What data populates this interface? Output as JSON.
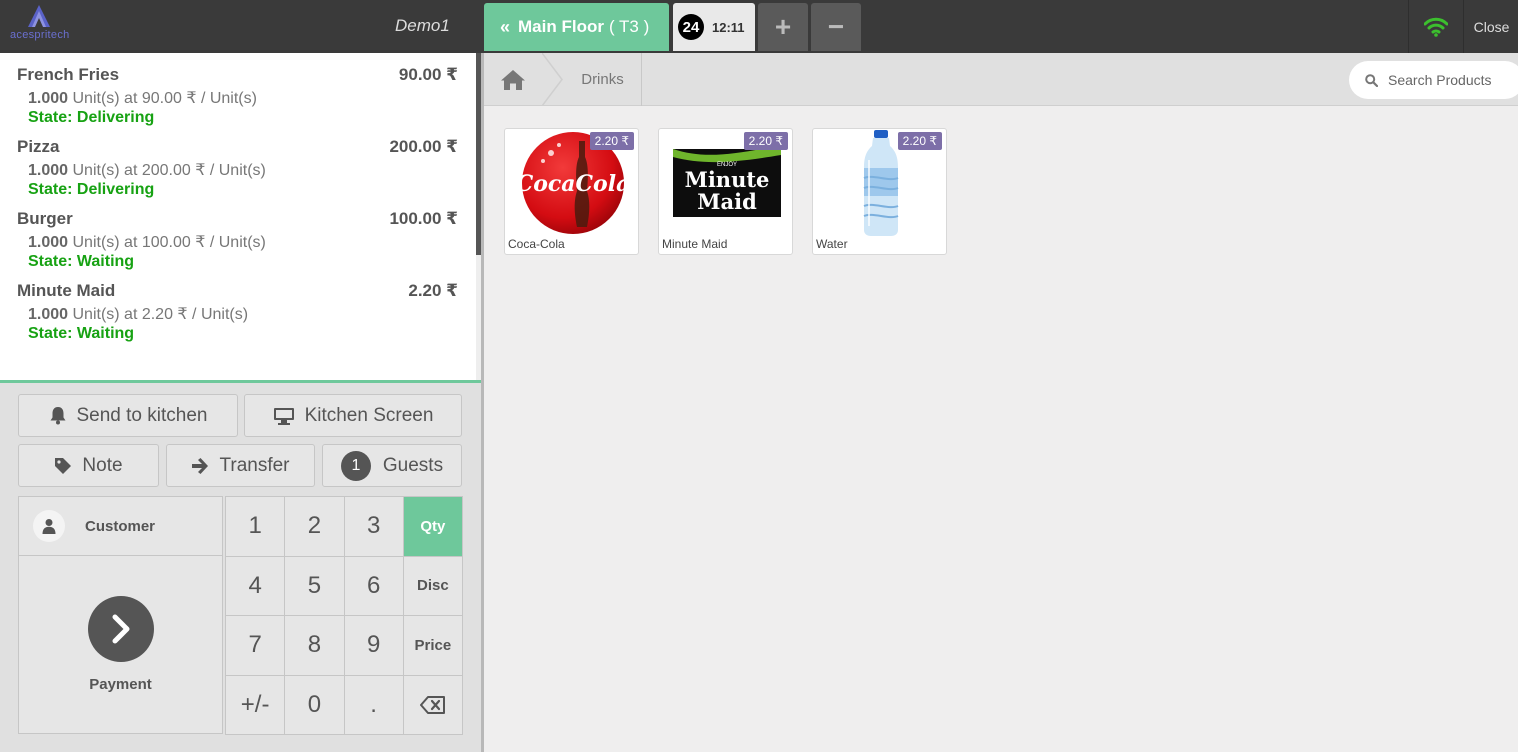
{
  "header": {
    "logo_text": "acespritech",
    "shop_name": "Demo1",
    "floor_label": "Main Floor",
    "table_label": "( T3 )",
    "order_number": "24",
    "order_time": "12:11",
    "add_order_symbol": "+",
    "remove_order_symbol": "−",
    "close_label": "Close",
    "wifi_color": "#3cbf2e"
  },
  "order": {
    "lines": [
      {
        "name": "French Fries",
        "price": "90.00 ₹",
        "qty": "1.000",
        "unit_info": " Unit(s) at 90.00 ₹ / Unit(s)",
        "state": "State: Delivering"
      },
      {
        "name": "Pizza",
        "price": "200.00 ₹",
        "qty": "1.000",
        "unit_info": " Unit(s) at 200.00 ₹ / Unit(s)",
        "state": "State: Delivering"
      },
      {
        "name": "Burger",
        "price": "100.00 ₹",
        "qty": "1.000",
        "unit_info": " Unit(s) at 100.00 ₹ / Unit(s)",
        "state": "State: Waiting"
      },
      {
        "name": "Minute Maid",
        "price": "2.20 ₹",
        "qty": "1.000",
        "unit_info": " Unit(s) at 2.20 ₹ / Unit(s)",
        "state": "State: Waiting"
      }
    ]
  },
  "controls": {
    "send_to_kitchen": "Send to kitchen",
    "kitchen_screen": "Kitchen Screen",
    "note": "Note",
    "transfer": "Transfer",
    "guest_count": "1",
    "guests": "Guests"
  },
  "pad": {
    "customer": "Customer",
    "payment": "Payment",
    "keys": [
      "1",
      "2",
      "3",
      "Qty",
      "4",
      "5",
      "6",
      "Disc",
      "7",
      "8",
      "9",
      "Price",
      "+/-",
      "0",
      "."
    ],
    "active_mode": "Qty"
  },
  "products_bar": {
    "breadcrumb": "Drinks",
    "search_placeholder": "Search Products"
  },
  "products": [
    {
      "name": "Coca-Cola",
      "price": "2.20 ₹"
    },
    {
      "name": "Minute Maid",
      "price": "2.20 ₹"
    },
    {
      "name": "Water",
      "price": "2.20 ₹"
    }
  ],
  "colors": {
    "accent_green": "#6ec89b",
    "state_green": "#17a213",
    "price_tag": "#7d6fa8",
    "topbar": "#3a3a3a"
  }
}
